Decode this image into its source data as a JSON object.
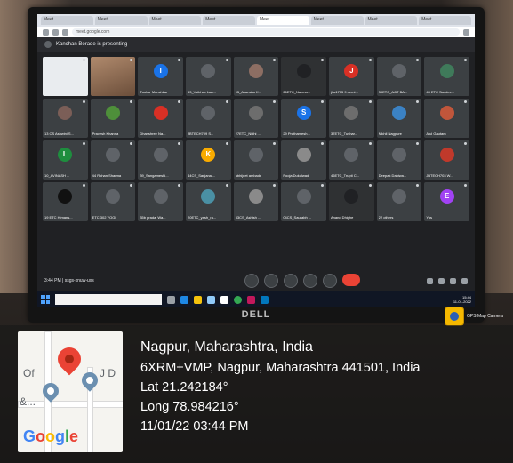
{
  "browser": {
    "tabs": [
      "Meet",
      "Meet",
      "Meet",
      "Meet",
      "Meet",
      "Meet",
      "Meet",
      "Meet"
    ],
    "url": "meet.google.com"
  },
  "meet": {
    "presenting_text": "Kanchan Borade is presenting",
    "tiles": [
      {
        "name": "",
        "kind": "share",
        "initial": "",
        "color": "#3c4043"
      },
      {
        "name": "",
        "kind": "video",
        "initial": "",
        "color": "#3c4043"
      },
      {
        "name": "Tushar Munshkar",
        "kind": "avatar",
        "initial": "T",
        "color": "#1a73e8"
      },
      {
        "name": "53_Vaibhav Lan...",
        "kind": "avatar",
        "initial": "",
        "color": "#5f6368"
      },
      {
        "name": "05_Akanshu K...",
        "kind": "avatar",
        "initial": "",
        "color": "#8d6e63"
      },
      {
        "name": "26ETC_Nazma...",
        "kind": "dark",
        "initial": "",
        "color": "#202124"
      },
      {
        "name": "jha1705 9 demi...",
        "kind": "avatar",
        "initial": "J",
        "color": "#d93025"
      },
      {
        "name": "39ETC_AJIT BA...",
        "kind": "avatar",
        "initial": "",
        "color": "#5f6368"
      },
      {
        "name": "43 ETC Sandee...",
        "kind": "avatar",
        "initial": "",
        "color": "#3f7a5a"
      },
      {
        "name": "13 CS Ashwini S...",
        "kind": "avatar",
        "initial": "",
        "color": "#7b5e57"
      },
      {
        "name": "Pravesh Khanna",
        "kind": "avatar",
        "initial": "",
        "color": "#4e8f3a"
      },
      {
        "name": "Dhanshree Na...",
        "kind": "avatar",
        "initial": "",
        "color": "#d93025"
      },
      {
        "name": "JBTECH709 S...",
        "kind": "avatar",
        "initial": "",
        "color": "#5f6368"
      },
      {
        "name": "27ETC_Nidhi ...",
        "kind": "avatar",
        "initial": "",
        "color": "#6d6d6d"
      },
      {
        "name": "29 Prathamesh...",
        "kind": "avatar",
        "initial": "S",
        "color": "#1a73e8"
      },
      {
        "name": "37ETC_Tushar...",
        "kind": "avatar",
        "initial": "",
        "color": "#6d6d6d"
      },
      {
        "name": "Nikhil Nagpure",
        "kind": "avatar",
        "initial": "",
        "color": "#3b82c4"
      },
      {
        "name": "Atul Gautam",
        "kind": "avatar",
        "initial": "",
        "color": "#c0563b"
      },
      {
        "name": "10_AVINASH ...",
        "kind": "avatar",
        "initial": "L",
        "color": "#1e8e3e"
      },
      {
        "name": "44 Rohan Sharma",
        "kind": "avatar",
        "initial": "",
        "color": "#5f6368"
      },
      {
        "name": "39_Sangameshi...",
        "kind": "avatar",
        "initial": "",
        "color": "#5f6368"
      },
      {
        "name": "44CS_Sanjana ...",
        "kind": "avatar",
        "initial": "K",
        "color": "#f9ab00"
      },
      {
        "name": "abhijeet ambade",
        "kind": "avatar",
        "initial": "",
        "color": "#5f6368"
      },
      {
        "name": "Pooja Dukulwad",
        "kind": "avatar",
        "initial": "",
        "color": "#8a8a8a"
      },
      {
        "name": "46ETC_Trupti C...",
        "kind": "avatar",
        "initial": "",
        "color": "#5f6368"
      },
      {
        "name": "Deepak Dahiwa...",
        "kind": "avatar",
        "initial": "",
        "color": "#5f6368"
      },
      {
        "name": "JBTECH703 W...",
        "kind": "avatar",
        "initial": "",
        "color": "#c0392b"
      },
      {
        "name": "19 ETC Himans...",
        "kind": "avatar",
        "initial": "",
        "color": "#111111"
      },
      {
        "name": "ETC 302 YOGI",
        "kind": "avatar",
        "initial": "",
        "color": "#5f6368"
      },
      {
        "name": "35b pradal Wa...",
        "kind": "avatar",
        "initial": "",
        "color": "#5f6368"
      },
      {
        "name": "20ETC_yash_ra...",
        "kind": "avatar",
        "initial": "",
        "color": "#4a90a4"
      },
      {
        "name": "33CS_Ashish ...",
        "kind": "avatar",
        "initial": "",
        "color": "#8a8a8a"
      },
      {
        "name": "04CS_Saurabh ...",
        "kind": "avatar",
        "initial": "",
        "color": "#5f6368"
      },
      {
        "name": "Anand Dhighe",
        "kind": "dark",
        "initial": "",
        "color": "#202124"
      },
      {
        "name": "22 others",
        "kind": "avatar",
        "initial": "",
        "color": "#5f6368"
      },
      {
        "name": "Yus",
        "kind": "avatar",
        "initial": "E",
        "color": "#a142f4"
      }
    ],
    "meeting_info": "3:44 PM | ssgs-xnuw-uxs"
  },
  "taskbar": {
    "time": "15:44",
    "date": "11-01-2022"
  },
  "watermark": {
    "app_label": "GPS Map Camera",
    "location_title": "Nagpur, Maharashtra, India",
    "address": "6XRM+VMP, Nagpur, Maharashtra 441501, India",
    "lat": "Lat 21.242184°",
    "long": "Long 78.984216°",
    "datetime": "11/01/22 03:44 PM",
    "map_labels": {
      "left": "Of",
      "right": "J D",
      "ellipsis": "&...",
      "google": "Google"
    }
  },
  "colors": {
    "meet_bg": "#202124",
    "tile_bg": "#3c4043",
    "end_call": "#ea4335",
    "pin_red": "#ea4335"
  }
}
